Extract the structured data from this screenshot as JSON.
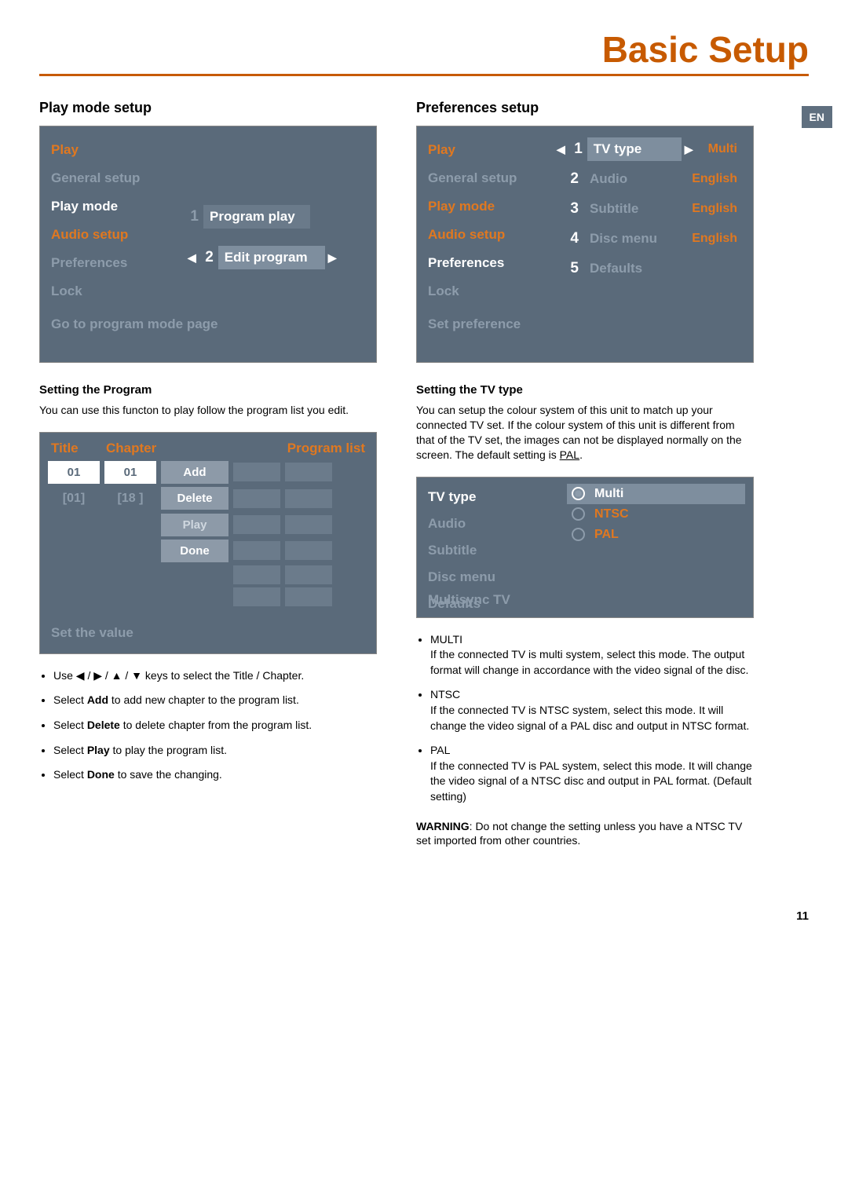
{
  "page": {
    "title": "Basic Setup",
    "lang_tab": "EN",
    "number": "11"
  },
  "left": {
    "section": "Play mode setup",
    "osd_menu": {
      "items": [
        "Play",
        "General setup",
        "Play mode",
        "Audio setup",
        "Preferences",
        "Lock"
      ],
      "right": {
        "row1_num": "1",
        "row1_label": "Program play",
        "row2_num": "2",
        "row2_label": "Edit program"
      },
      "footer": "Go to program mode page"
    },
    "sub1_title": "Setting the Program",
    "sub1_body": "You can use this functon to play follow the program list you edit.",
    "osd_prog": {
      "titles": {
        "title": "Title",
        "chapter": "Chapter",
        "plist": "Program list"
      },
      "title_val": "01",
      "chapter_val": "01",
      "title_max": "[01]",
      "chapter_max": "[18 ]",
      "btn_add": "Add",
      "btn_delete": "Delete",
      "btn_play": "Play",
      "btn_done": "Done",
      "footer": "Set the value"
    },
    "bullets": [
      {
        "pre": "Use ◀ / ▶ / ▲ / ▼  keys to select the Title / Chapter."
      },
      {
        "pre": "Select ",
        "b": "Add",
        "post": " to add new chapter to the program list."
      },
      {
        "pre": "Select ",
        "b": "Delete",
        "post": " to delete chapter from the program list."
      },
      {
        "pre": "Select ",
        "b": "Play",
        "post": " to play the program list."
      },
      {
        "pre": "Select ",
        "b": "Done",
        "post": " to save the changing."
      }
    ]
  },
  "right": {
    "section": "Preferences setup",
    "osd_pref": {
      "left_items": [
        "Play",
        "General setup",
        "Play mode",
        "Audio setup",
        "Preferences",
        "Lock"
      ],
      "rows": [
        {
          "n": "1",
          "label": "TV type",
          "value": "Multi",
          "hi": true
        },
        {
          "n": "2",
          "label": "Audio",
          "value": "English"
        },
        {
          "n": "3",
          "label": "Subtitle",
          "value": "English"
        },
        {
          "n": "4",
          "label": "Disc menu",
          "value": "English"
        },
        {
          "n": "5",
          "label": "Defaults",
          "value": ""
        }
      ],
      "footer": "Set preference"
    },
    "sub1_title": "Setting the TV type",
    "sub1_body_a": "You can setup the colour system of this unit to match up your connected TV set. If the colour system of this unit is different from that of the TV set, the images can not be displayed normally on the screen. The default setting is ",
    "sub1_body_u": "PAL",
    "sub1_body_b": ".",
    "osd_tv": {
      "left": [
        "TV type",
        "Audio",
        "Subtitle",
        "Disc menu",
        "Defaults"
      ],
      "opts": [
        "Multi",
        "NTSC",
        "PAL"
      ],
      "footer": "Multisync TV"
    },
    "bullets": [
      {
        "h": "MULTI",
        "t": "If the connected TV is multi system, select this mode. The output format will change in accordance with the video signal of the disc."
      },
      {
        "h": "NTSC",
        "t": "If the connected TV is NTSC system, select this mode. It will change the video signal of a PAL disc and output in NTSC format."
      },
      {
        "h": "PAL",
        "t": "If the connected TV is PAL system, select this mode. It will change the video signal of a NTSC disc and output in PAL format.  (Default setting)"
      }
    ],
    "warning_b": "WARNING",
    "warning_t": ": Do not change the setting unless you have a NTSC TV set imported from other countries."
  }
}
